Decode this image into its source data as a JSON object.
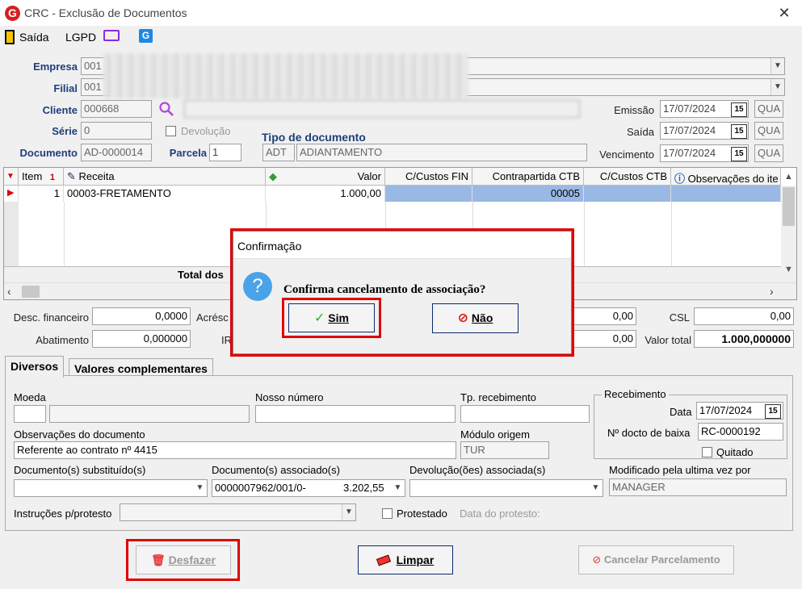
{
  "window": {
    "title": "CRC - Exclusão de Documentos",
    "close_glyph": "✕"
  },
  "toolbar": {
    "saida": "Saída",
    "lgpd": "LGPD"
  },
  "form": {
    "empresa_label": "Empresa",
    "empresa_code": "001",
    "filial_label": "Filial",
    "filial_code": "001",
    "cliente_label": "Cliente",
    "cliente_code": "000668",
    "serie_label": "Série",
    "serie_value": "0",
    "devolucao_label": "Devolução",
    "tipo_doc_label": "Tipo de documento",
    "tipo_doc_code": "ADT",
    "tipo_doc_desc": "ADIANTAMENTO",
    "documento_label": "Documento",
    "documento_value": "AD-0000014",
    "parcela_label": "Parcela",
    "parcela_value": "1",
    "emissao_label": "Emissão",
    "emissao_value": "17/07/2024",
    "emissao_day": "QUA",
    "saida_label": "Saída",
    "saida_value": "17/07/2024",
    "saida_day": "QUA",
    "vencimento_label": "Vencimento",
    "vencimento_value": "17/07/2024",
    "vencimento_day": "QUA",
    "date_btn": "15"
  },
  "grid": {
    "headers": {
      "item": "Item",
      "receita": "Receita",
      "valor": "Valor",
      "custos_fin": "C/Custos FIN",
      "contrapartida": "Contrapartida CTB",
      "custos_ctb": "C/Custos CTB",
      "obs": "Observações do ite"
    },
    "row": {
      "item": "1",
      "receita": "00003-FRETAMENTO",
      "valor": "1.000,00",
      "contrapartida": "00005"
    },
    "total_label": "Total dos"
  },
  "totals": {
    "desc_fin_label": "Desc. financeiro",
    "desc_fin_value": "0,0000",
    "acresc_label": "Acrésc",
    "abatimento_label": "Abatimento",
    "abatimento_value": "0,000000",
    "ir_label": "IR",
    "field_a": "0,00",
    "field_b": "0,00",
    "csl_label": "CSL",
    "csl_value": "0,00",
    "valor_total_label": "Valor total",
    "valor_total_value": "1.000,000000"
  },
  "tabs": {
    "diversos": "Diversos",
    "valores": "Valores complementares"
  },
  "panel": {
    "moeda_label": "Moeda",
    "nosso_numero_label": "Nosso número",
    "tp_receb_label": "Tp. recebimento",
    "obs_doc_label": "Observações do documento",
    "obs_doc_value": "Referente ao contrato nº 4415",
    "modulo_label": "Módulo origem",
    "modulo_value": "TUR",
    "doc_subst_label": "Documento(s) substituído(s)",
    "doc_assoc_label": "Documento(s) associado(s)",
    "doc_assoc_value": "0000007962/001/0-",
    "doc_assoc_amount": "3.202,55",
    "devol_assoc_label": "Devolução(ões) associada(s)",
    "modificado_label": "Modificado pela ultima vez por",
    "modificado_value": "MANAGER",
    "instrucoes_label": "Instruções p/protesto",
    "protestado_label": "Protestado",
    "data_protesto_label": "Data do protesto:",
    "recebimento_group": "Recebimento",
    "data_label": "Data",
    "data_value": "17/07/2024",
    "ndocto_label": "Nº docto de baixa",
    "ndocto_value": "RC-0000192",
    "quitado_label": "Quitado"
  },
  "buttons": {
    "desfazer": "Desfazer",
    "limpar": "Limpar",
    "cancelar_parc": "Cancelar Parcelamento"
  },
  "dialog": {
    "title": "Confirmação",
    "question_glyph": "?",
    "message": "Confirma cancelamento de associação?",
    "sim": "Sim",
    "nao": "Não"
  }
}
